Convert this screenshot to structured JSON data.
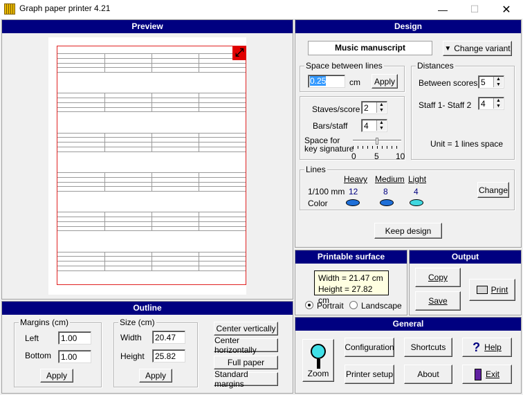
{
  "window": {
    "title": "Graph paper printer 4.21"
  },
  "preview": {
    "title": "Preview",
    "staves": 6,
    "lines_per_staff": 5,
    "bars_per_staff": 4
  },
  "design": {
    "title": "Design",
    "template_name": "Music manuscript",
    "change_variant_label": "Change variant",
    "space_group": {
      "title": "Space between lines",
      "value": "0.25",
      "unit": "cm",
      "apply_label": "Apply"
    },
    "staves_label": "Staves/score",
    "staves_value": "2",
    "bars_label": "Bars/staff",
    "bars_value": "4",
    "keysig_label_1": "Space for",
    "keysig_label_2": "key signature",
    "keysig_ticks": [
      "0",
      "5",
      "10"
    ],
    "distances": {
      "title": "Distances",
      "between_scores_label": "Between scores",
      "between_scores_value": "5",
      "staff_label": "Staff 1- Staff 2",
      "staff_value": "4",
      "unit_note": "Unit = 1 lines space"
    },
    "lines": {
      "title": "Lines",
      "row_label_width": "1/100 mm",
      "row_label_color": "Color",
      "heavy": {
        "label": "Heavy",
        "value": "12",
        "color": "#1e6fd8"
      },
      "medium": {
        "label": "Medium",
        "value": "8",
        "color": "#1e6fd8"
      },
      "light": {
        "label": "Light",
        "value": "4",
        "color": "#40d8e0"
      },
      "change_label": "Change"
    },
    "keep_label": "Keep design"
  },
  "outline": {
    "title": "Outline",
    "margins": {
      "title": "Margins (cm)",
      "left_label": "Left",
      "left_value": "1.00",
      "bottom_label": "Bottom",
      "bottom_value": "1.00",
      "apply_label": "Apply"
    },
    "size": {
      "title": "Size (cm)",
      "width_label": "Width",
      "width_value": "20.47",
      "height_label": "Height",
      "height_value": "25.82",
      "apply_label": "Apply"
    },
    "center_vertically": "Center vertically",
    "center_horizontally": "Center horizontally",
    "full_paper": "Full paper",
    "standard_margins": "Standard margins"
  },
  "printable": {
    "title": "Printable surface",
    "width_text": "Width = 21.47 cm",
    "height_text": "Height = 27.82 cm",
    "portrait": "Portrait",
    "landscape": "Landscape"
  },
  "output": {
    "title": "Output",
    "copy": "Copy",
    "save": "Save",
    "print": "Print"
  },
  "general": {
    "title": "General",
    "zoom": "Zoom",
    "configuration": "Configuration",
    "shortcuts": "Shortcuts",
    "help": "Help",
    "printer_setup": "Printer setup",
    "about": "About",
    "exit": "Exit"
  }
}
